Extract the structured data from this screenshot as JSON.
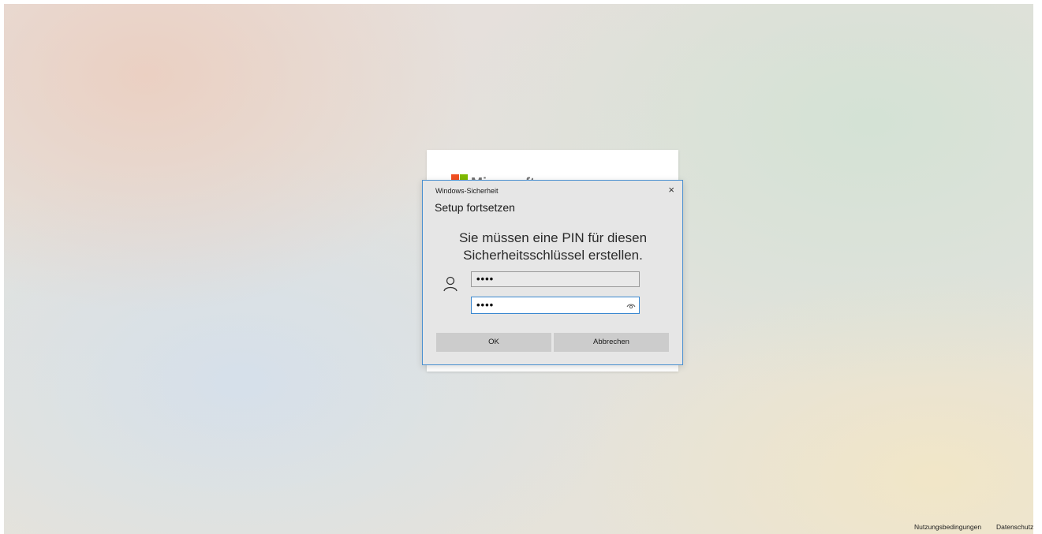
{
  "background_card": {
    "brand_text": "Microsoft",
    "logo_colors": [
      "#f25022",
      "#7fba00",
      "#00a4ef",
      "#ffb900"
    ]
  },
  "dialog": {
    "caption": "Windows-Sicherheit",
    "close_glyph": "×",
    "title": "Setup fortsetzen",
    "message": "Sie müssen eine PIN für diesen Sicherheitsschlüssel erstellen.",
    "pin_value": "••••",
    "confirm_pin_value": "••••",
    "ok_label": "OK",
    "cancel_label": "Abbrechen",
    "accent_color": "#4a90d0",
    "icons": [
      "user-icon",
      "eye-icon"
    ]
  },
  "footer": {
    "terms_label": "Nutzungsbedingungen",
    "privacy_label": "Datenschutz"
  }
}
